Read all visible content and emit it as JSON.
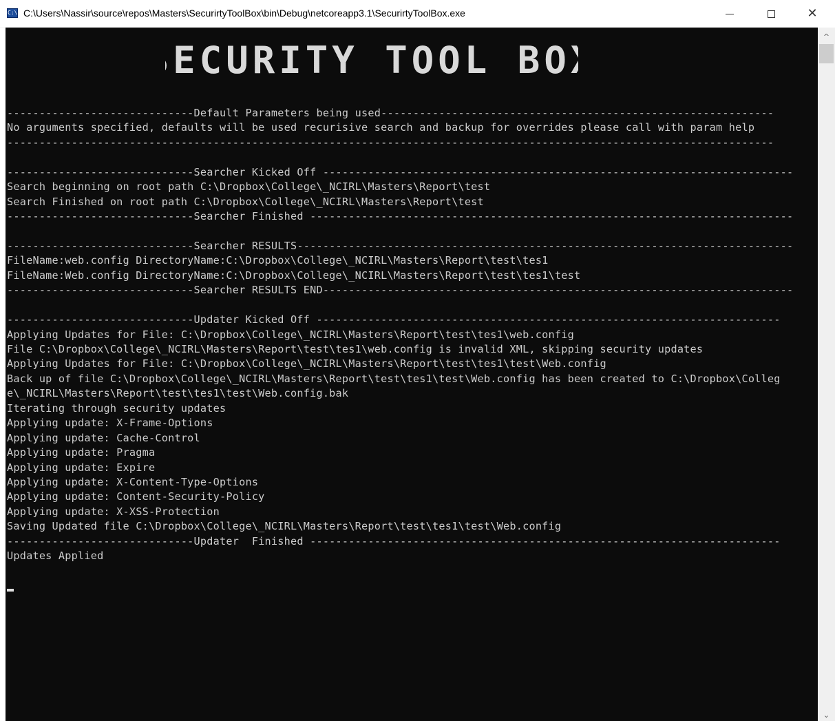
{
  "window": {
    "title": "C:\\Users\\Nassir\\source\\repos\\Masters\\SecurirtyToolBox\\bin\\Debug\\netcoreapp3.1\\SecurirtyToolBox.exe",
    "icon": "console-app-icon",
    "icon_text": "C:\\",
    "controls": {
      "minimize": "minimize-icon",
      "maximize": "maximize-icon",
      "close_label": "✕"
    }
  },
  "banner": {
    "text": "SECURITY TOOL BOX",
    "color": "#d9d9d9"
  },
  "console": {
    "background": "#0c0c0c",
    "foreground": "#cccccc",
    "lines": [
      "-----------------------------Default Parameters being used-------------------------------------------------------------",
      "No arguments specified, defaults will be used recurisive search and backup for overrides please call with param help",
      "-----------------------------------------------------------------------------------------------------------------------",
      "",
      "-----------------------------Searcher Kicked Off -------------------------------------------------------------------------",
      "Search beginning on root path C:\\Dropbox\\College\\_NCIRL\\Masters\\Report\\test",
      "Search Finished on root path C:\\Dropbox\\College\\_NCIRL\\Masters\\Report\\test",
      "-----------------------------Searcher Finished ---------------------------------------------------------------------------",
      "",
      "-----------------------------Searcher RESULTS-----------------------------------------------------------------------------",
      "FileName:web.config DirectoryName:C:\\Dropbox\\College\\_NCIRL\\Masters\\Report\\test\\tes1",
      "FileName:Web.config DirectoryName:C:\\Dropbox\\College\\_NCIRL\\Masters\\Report\\test\\tes1\\test",
      "-----------------------------Searcher RESULTS END-------------------------------------------------------------------------",
      "",
      "-----------------------------Updater Kicked Off ------------------------------------------------------------------------",
      "Applying Updates for File: C:\\Dropbox\\College\\_NCIRL\\Masters\\Report\\test\\tes1\\web.config",
      "File C:\\Dropbox\\College\\_NCIRL\\Masters\\Report\\test\\tes1\\web.config is invalid XML, skipping security updates",
      "Applying Updates for File: C:\\Dropbox\\College\\_NCIRL\\Masters\\Report\\test\\tes1\\test\\Web.config",
      "Back up of file C:\\Dropbox\\College\\_NCIRL\\Masters\\Report\\test\\tes1\\test\\Web.config has been created to C:\\Dropbox\\Colleg",
      "e\\_NCIRL\\Masters\\Report\\test\\tes1\\test\\Web.config.bak",
      "Iterating through security updates",
      "Applying update: X-Frame-Options",
      "Applying update: Cache-Control",
      "Applying update: Pragma",
      "Applying update: Expire",
      "Applying update: X-Content-Type-Options",
      "Applying update: Content-Security-Policy",
      "Applying update: X-XSS-Protection",
      "Saving Updated file C:\\Dropbox\\College\\_NCIRL\\Masters\\Report\\test\\tes1\\test\\Web.config",
      "-----------------------------Updater  Finished -------------------------------------------------------------------------",
      "Updates Applied"
    ]
  },
  "scrollbar": {
    "up_icon": "chevron-up-icon",
    "down_icon": "chevron-down-icon",
    "up_label": "^",
    "down_label": "⌄"
  }
}
